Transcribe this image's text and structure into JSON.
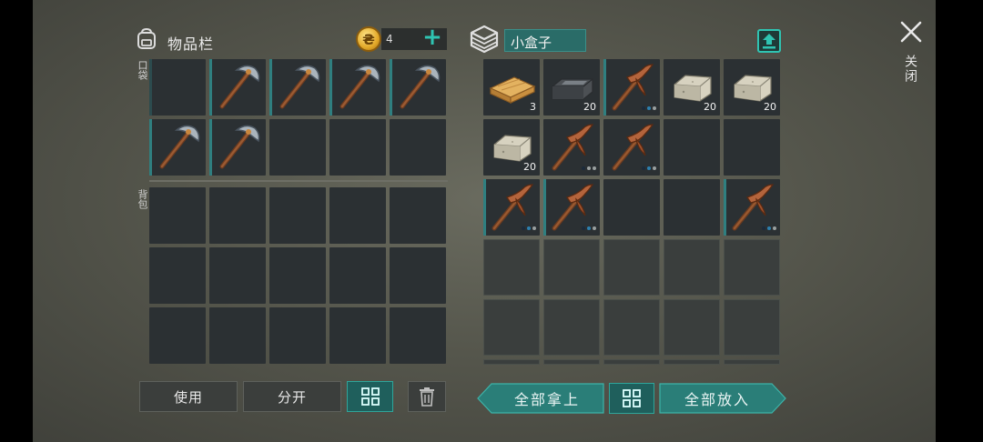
{
  "inventory": {
    "title": "物品栏",
    "coins": "4",
    "pocket_label": "口袋",
    "backpack_label": "背包",
    "buttons": {
      "use": "使用",
      "split": "分开"
    },
    "pocket_slots": [
      "empty",
      "stone-pickaxe",
      "stone-pickaxe",
      "stone-pickaxe",
      "stone-pickaxe",
      "stone-pickaxe",
      "stone-pickaxe",
      "empty",
      "empty",
      "empty"
    ],
    "backpack_slots": 15
  },
  "container": {
    "name": "小盒子",
    "buttons": {
      "take_all": "全部拿上",
      "put_all": "全部放入"
    },
    "slots": [
      {
        "item": "wood-plank",
        "qty": "3"
      },
      {
        "item": "iron-ingot",
        "qty": "20"
      },
      {
        "item": "copper-pickaxe",
        "durability": [
          1,
          2,
          0
        ]
      },
      {
        "item": "stone-block",
        "qty": "20"
      },
      {
        "item": "stone-block",
        "qty": "20"
      },
      {
        "item": "stone-block",
        "qty": "20"
      },
      {
        "item": "copper-pickaxe",
        "durability": [
          1,
          0,
          0
        ]
      },
      {
        "item": "copper-pickaxe",
        "durability": [
          1,
          2,
          0
        ]
      },
      {
        "item": "empty"
      },
      {
        "item": "empty"
      },
      {
        "item": "copper-pickaxe",
        "durability": [
          1,
          2,
          0
        ]
      },
      {
        "item": "copper-pickaxe",
        "durability": [
          1,
          2,
          0
        ]
      },
      {
        "item": "empty"
      },
      {
        "item": "empty"
      },
      {
        "item": "copper-pickaxe",
        "durability": [
          1,
          2,
          0
        ]
      }
    ],
    "locked_rows": 3
  },
  "close_label": "关闭",
  "colors": {
    "accent": "#2fc4b2",
    "teal_dark": "#1f5f5c",
    "slot": "#2b3033"
  }
}
